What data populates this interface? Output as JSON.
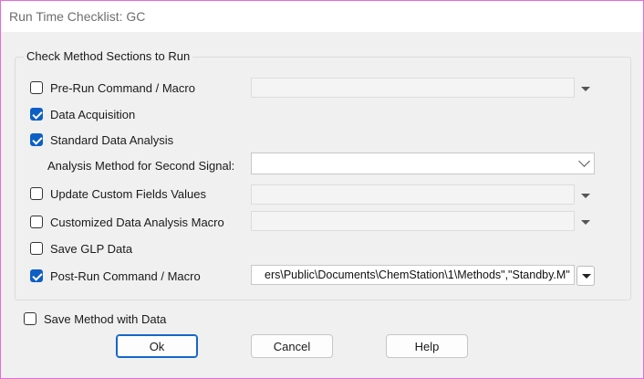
{
  "window": {
    "title": "Run Time Checklist: GC"
  },
  "group": {
    "label": "Check Method Sections to Run"
  },
  "sections": {
    "pre_run": {
      "label": "Pre-Run Command / Macro",
      "checked": false,
      "value": ""
    },
    "data_acquisition": {
      "label": "Data Acquisition",
      "checked": true
    },
    "standard_analysis": {
      "label": "Standard Data Analysis",
      "checked": true
    },
    "second_signal": {
      "label": "Analysis Method for Second Signal:",
      "value": ""
    },
    "custom_fields": {
      "label": "Update Custom Fields Values",
      "checked": false,
      "value": ""
    },
    "custom_macro": {
      "label": "Customized Data Analysis Macro",
      "checked": false,
      "value": ""
    },
    "save_glp": {
      "label": "Save GLP Data",
      "checked": false
    },
    "post_run": {
      "label": "Post-Run Command / Macro",
      "checked": true,
      "value": "ers\\Public\\Documents\\ChemStation\\1\\Methods\",\"Standby.M\""
    }
  },
  "save_method": {
    "label": "Save Method with Data",
    "checked": false
  },
  "buttons": {
    "ok": "Ok",
    "cancel": "Cancel",
    "help": "Help"
  },
  "colors": {
    "accent": "#0e5fc4",
    "window_border": "#e86ad6"
  }
}
